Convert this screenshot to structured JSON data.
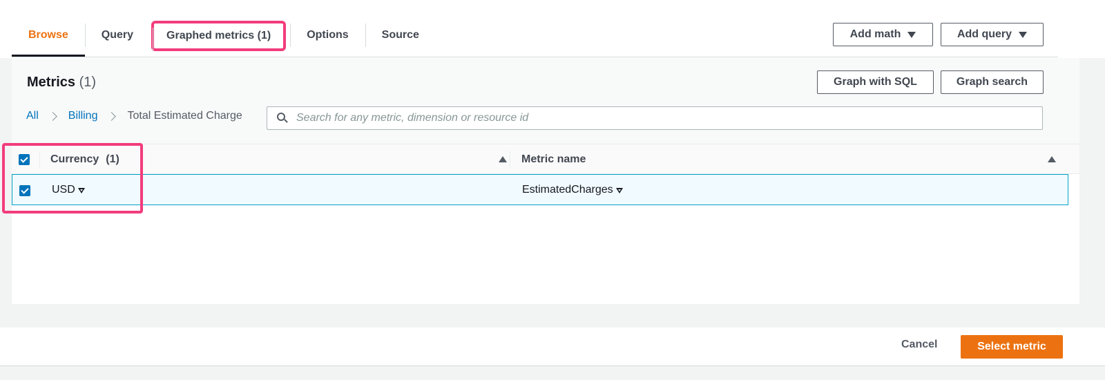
{
  "tabs": [
    {
      "label": "Browse"
    },
    {
      "label": "Query"
    },
    {
      "label": "Graphed metrics (1)"
    },
    {
      "label": "Options"
    },
    {
      "label": "Source"
    }
  ],
  "toolbar": {
    "add_math": "Add math",
    "add_query": "Add query"
  },
  "metrics": {
    "title": "Metrics",
    "count": "(1)",
    "graph_sql": "Graph with SQL",
    "graph_search": "Graph search"
  },
  "breadcrumb": {
    "all": "All",
    "billing": "Billing",
    "current": "Total Estimated Charge"
  },
  "search": {
    "placeholder": "Search for any metric, dimension or resource id"
  },
  "table": {
    "headers": {
      "currency": "Currency",
      "currency_count": "(1)",
      "metric_name": "Metric name"
    },
    "rows": [
      {
        "currency": "USD",
        "metric_name": "EstimatedCharges"
      }
    ]
  },
  "footer": {
    "cancel": "Cancel",
    "select": "Select metric"
  },
  "colors": {
    "accent": "#ec7211",
    "link": "#0073bb",
    "highlight": "#f23c7c"
  }
}
